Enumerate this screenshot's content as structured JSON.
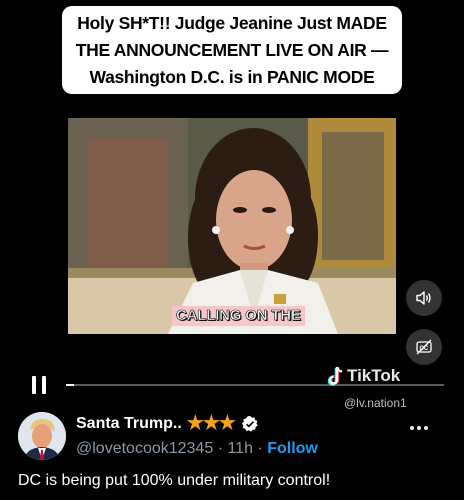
{
  "headline": {
    "line1": "Holy SH*T!! Judge Jeanine Just MADE",
    "line2": "THE ANNOUNCEMENT LIVE ON AIR —",
    "line3": "Washington D.C. is in PANIC MODE"
  },
  "video": {
    "caption": "CALLING ON THE",
    "progress_fraction": 0.02,
    "watermark_brand": "TikTok",
    "watermark_handle": "@lv.nation1"
  },
  "controls": {
    "pause_icon": "pause-icon",
    "volume_icon": "speaker-icon",
    "captions_icon": "captions-off-icon"
  },
  "post": {
    "author_name": "Santa Trump..",
    "badges": "★★★",
    "handle": "@lovetocook12345",
    "separator": "·",
    "time": "11h",
    "follow_label": "Follow",
    "text": "DC is being put 100% under military control!"
  },
  "colors": {
    "accent": "#1d9bf0",
    "star": "#f4a31c",
    "background": "#000000"
  }
}
